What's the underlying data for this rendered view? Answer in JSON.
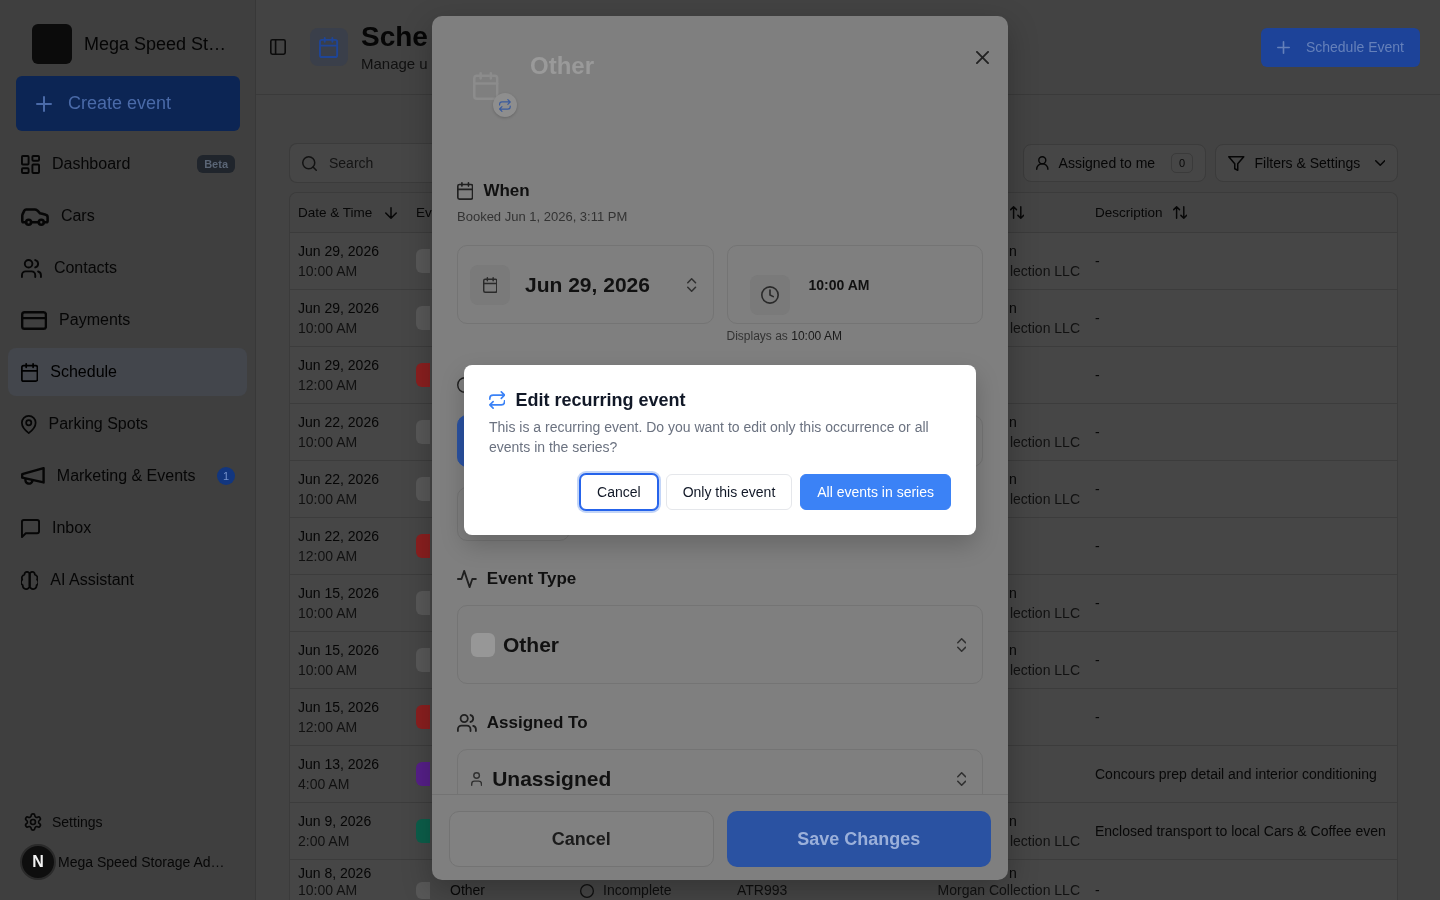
{
  "sidebar": {
    "brand": "Mega Speed St…",
    "create_button": "Create event",
    "items": [
      {
        "label": "Dashboard",
        "selected": false,
        "badge": {
          "kind": "tag",
          "text": "Beta"
        }
      },
      {
        "label": "Cars",
        "selected": false
      },
      {
        "label": "Contacts",
        "selected": false
      },
      {
        "label": "Payments",
        "selected": false
      },
      {
        "label": "Schedule",
        "selected": true
      },
      {
        "label": "Parking Spots",
        "selected": false
      },
      {
        "label": "Marketing & Events",
        "selected": false,
        "badge": {
          "kind": "count",
          "text": "1"
        }
      },
      {
        "label": "Inbox",
        "selected": false
      },
      {
        "label": "AI Assistant",
        "selected": false
      }
    ],
    "settings": "Settings",
    "account": "Mega Speed Storage Ad…"
  },
  "dev_indicator": "N",
  "header": {
    "title": "Sche",
    "subtitle": "Manage u",
    "action": "Schedule Event"
  },
  "toolbar": {
    "search": {
      "placeholder": "Search"
    },
    "assigned_filter": {
      "label": "Assigned to me",
      "count": "0"
    },
    "filters": "Filters & Settings"
  },
  "table": {
    "columns": [
      {
        "label": "Date & Time",
        "sorted": true
      },
      {
        "label": "Ev"
      },
      {
        "sorted": false
      },
      {
        "label": "Description",
        "sorted": false
      }
    ],
    "rows": [
      {
        "date": "Jun 29, 2026",
        "time": "10:00 AM",
        "color": "#585858",
        "customer": {
          "name": "n",
          "company": "lection LLC"
        },
        "description": "-"
      },
      {
        "date": "Jun 29, 2026",
        "time": "10:00 AM",
        "color": "#585858",
        "customer": {
          "name": "n",
          "company": "lection LLC"
        },
        "description": "-"
      },
      {
        "date": "Jun 29, 2026",
        "time": "12:00 AM",
        "color": "#8a1f1f",
        "description": "-"
      },
      {
        "date": "Jun 22, 2026",
        "time": "10:00 AM",
        "color": "#585858",
        "customer": {
          "name": "n",
          "company": "lection LLC"
        },
        "description": "-"
      },
      {
        "date": "Jun 22, 2026",
        "time": "10:00 AM",
        "color": "#585858",
        "customer": {
          "name": "n",
          "company": "lection LLC"
        },
        "description": "-"
      },
      {
        "date": "Jun 22, 2026",
        "time": "12:00 AM",
        "color": "#8a1f1f",
        "description": "-"
      },
      {
        "date": "Jun 15, 2026",
        "time": "10:00 AM",
        "color": "#585858",
        "customer": {
          "name": "n",
          "company": "lection LLC"
        },
        "description": "-"
      },
      {
        "date": "Jun 15, 2026",
        "time": "10:00 AM",
        "color": "#585858",
        "customer": {
          "name": "n",
          "company": "lection LLC"
        },
        "description": "-"
      },
      {
        "date": "Jun 15, 2026",
        "time": "12:00 AM",
        "color": "#8a1f1f",
        "description": "-"
      },
      {
        "date": "Jun 13, 2026",
        "time": "4:00 AM",
        "color": "#561f88",
        "description": "Concours prep detail and interior conditioning"
      },
      {
        "date": "Jun 9, 2026",
        "time": "2:00 AM",
        "color": "#0c5e4a",
        "customer": {
          "name": "n",
          "company": "lection LLC"
        },
        "description": "Enclosed transport to local Cars & Coffee even"
      },
      {
        "date": "Jun 8, 2026",
        "time": "10:00 AM",
        "color": "#585858",
        "event": "Other",
        "status": "Incomplete",
        "vehicle": "ATR993",
        "customer": {
          "name": "n",
          "company": "Morgan Collection LLC"
        },
        "description": "-"
      }
    ]
  },
  "modal": {
    "title": "Other",
    "when": {
      "heading": "When",
      "booked": "Booked Jun 1, 2026, 3:11 PM",
      "date": "Jun 29, 2026",
      "time": "10:00 AM",
      "display_note": {
        "label": "Displays as",
        "value": "10:00 AM"
      }
    },
    "options_section": {
      "options": [
        {
          "selected": true
        },
        {
          "selected": false
        }
      ]
    },
    "event_type": {
      "heading": "Event Type",
      "value": "Other"
    },
    "assigned_to": {
      "heading": "Assigned To",
      "value": "Unassigned"
    },
    "buttons": [
      {
        "label": "Cancel",
        "kind": "secondary"
      },
      {
        "label": "Save Changes",
        "kind": "primary"
      }
    ]
  },
  "confirm": {
    "title": "Edit recurring event",
    "message": "This is a recurring event. Do you want to edit only this occurrence or all events in the series?",
    "buttons": [
      {
        "label": "Cancel",
        "kind": "outline",
        "focused": true
      },
      {
        "label": "Only this event",
        "kind": "outline",
        "focused": false
      },
      {
        "label": "All events in series",
        "kind": "primary",
        "focused": false
      }
    ]
  }
}
